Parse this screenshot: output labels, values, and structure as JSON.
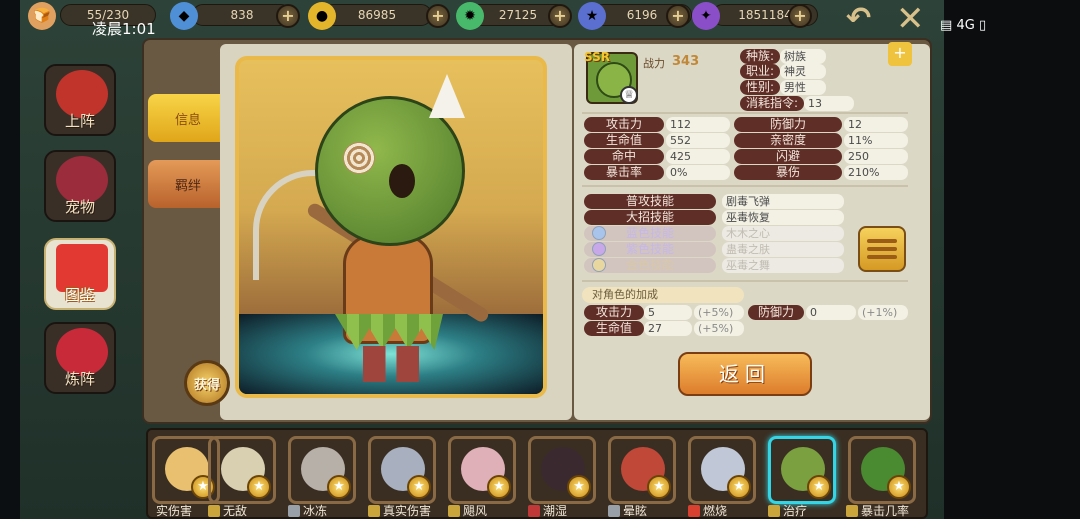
{
  "status": {
    "clock": "凌晨1:01",
    "network": "4G"
  },
  "resources": [
    {
      "name": "stamina",
      "value": "55/230",
      "icon": "bread-icon",
      "color": "#e0a060"
    },
    {
      "name": "diamond",
      "value": "838",
      "icon": "diamond-icon",
      "color": "#4f8fd6"
    },
    {
      "name": "gold",
      "value": "86985",
      "icon": "gold-coin-icon",
      "color": "#e3b52a"
    },
    {
      "name": "candy",
      "value": "27125",
      "icon": "lollipop-icon",
      "color": "#48b86a"
    },
    {
      "name": "honor",
      "value": "6196",
      "icon": "honor-badge-icon",
      "color": "#5a6fd0"
    },
    {
      "name": "star",
      "value": "1851184",
      "icon": "purple-star-icon",
      "color": "#8a4fc8"
    }
  ],
  "sidebar": [
    {
      "label": "上阵",
      "color": "#c0342c"
    },
    {
      "label": "宠物",
      "color": "#9a2c3c"
    },
    {
      "label": "图鉴",
      "color": "#e23a32"
    },
    {
      "label": "炼阵",
      "color": "#c82a3a"
    }
  ],
  "tabs": {
    "info": "信息",
    "bond": "羁绊"
  },
  "obtain_label": "获得",
  "hero": {
    "rarity": "SSR",
    "power_label": "战力",
    "power": "343",
    "race_label": "种族:",
    "race": "树族",
    "class_label": "职业:",
    "class": "神灵",
    "gender_label": "性别:",
    "gender": "男性",
    "command_label": "消耗指令:",
    "command": "13"
  },
  "stats": [
    {
      "label": "攻击力",
      "value": "112",
      "label2": "防御力",
      "value2": "12"
    },
    {
      "label": "生命值",
      "value": "552",
      "label2": "亲密度",
      "value2": "11%"
    },
    {
      "label": "命中",
      "value": "425",
      "label2": "闪避",
      "value2": "250"
    },
    {
      "label": "暴击率",
      "value": "0%",
      "label2": "暴伤",
      "value2": "210%"
    }
  ],
  "skills": [
    {
      "label": "普攻技能",
      "value": "剧毒飞弹"
    },
    {
      "label": "大招技能",
      "value": "巫毒恢复"
    },
    {
      "label": "蓝色技能",
      "value": "木木之心"
    },
    {
      "label": "紫色技能",
      "value": "蛊毒之肤"
    },
    {
      "label": "金色技能",
      "value": "巫毒之舞"
    }
  ],
  "bonus": {
    "title": "对角色的加成",
    "rows": [
      {
        "label": "攻击力",
        "value": "5",
        "pct": "(+5%)",
        "label2": "防御力",
        "value2": "0",
        "pct2": "(+1%)"
      },
      {
        "label": "生命值",
        "value": "27",
        "pct": "(+5%)"
      }
    ]
  },
  "return_label": "返回",
  "roster": [
    {
      "label": "实伤害",
      "color": "#e8c070",
      "tag": ""
    },
    {
      "label": "无敌",
      "color": "#d8d0b0",
      "tag": "#c9a53c"
    },
    {
      "label": "冰冻",
      "color": "#b6b0a8",
      "tag": "#9aa0a8"
    },
    {
      "label": "真实伤害",
      "color": "#a8b0c0",
      "tag": "#c9a53c"
    },
    {
      "label": "飓风",
      "color": "#e0b0b8",
      "tag": "#c9a53c"
    },
    {
      "label": "潮湿",
      "color": "#3a2a30",
      "tag": "#c03838"
    },
    {
      "label": "晕眩",
      "color": "#c04838",
      "tag": "#9aa0a8"
    },
    {
      "label": "燃烧",
      "color": "#c0c8d8",
      "tag": "#d84030"
    },
    {
      "label": "治疗",
      "color": "#7aa040",
      "tag": "#c9a53c"
    },
    {
      "label": "暴击几率",
      "color": "#4a8a30",
      "tag": "#c9a53c"
    }
  ]
}
